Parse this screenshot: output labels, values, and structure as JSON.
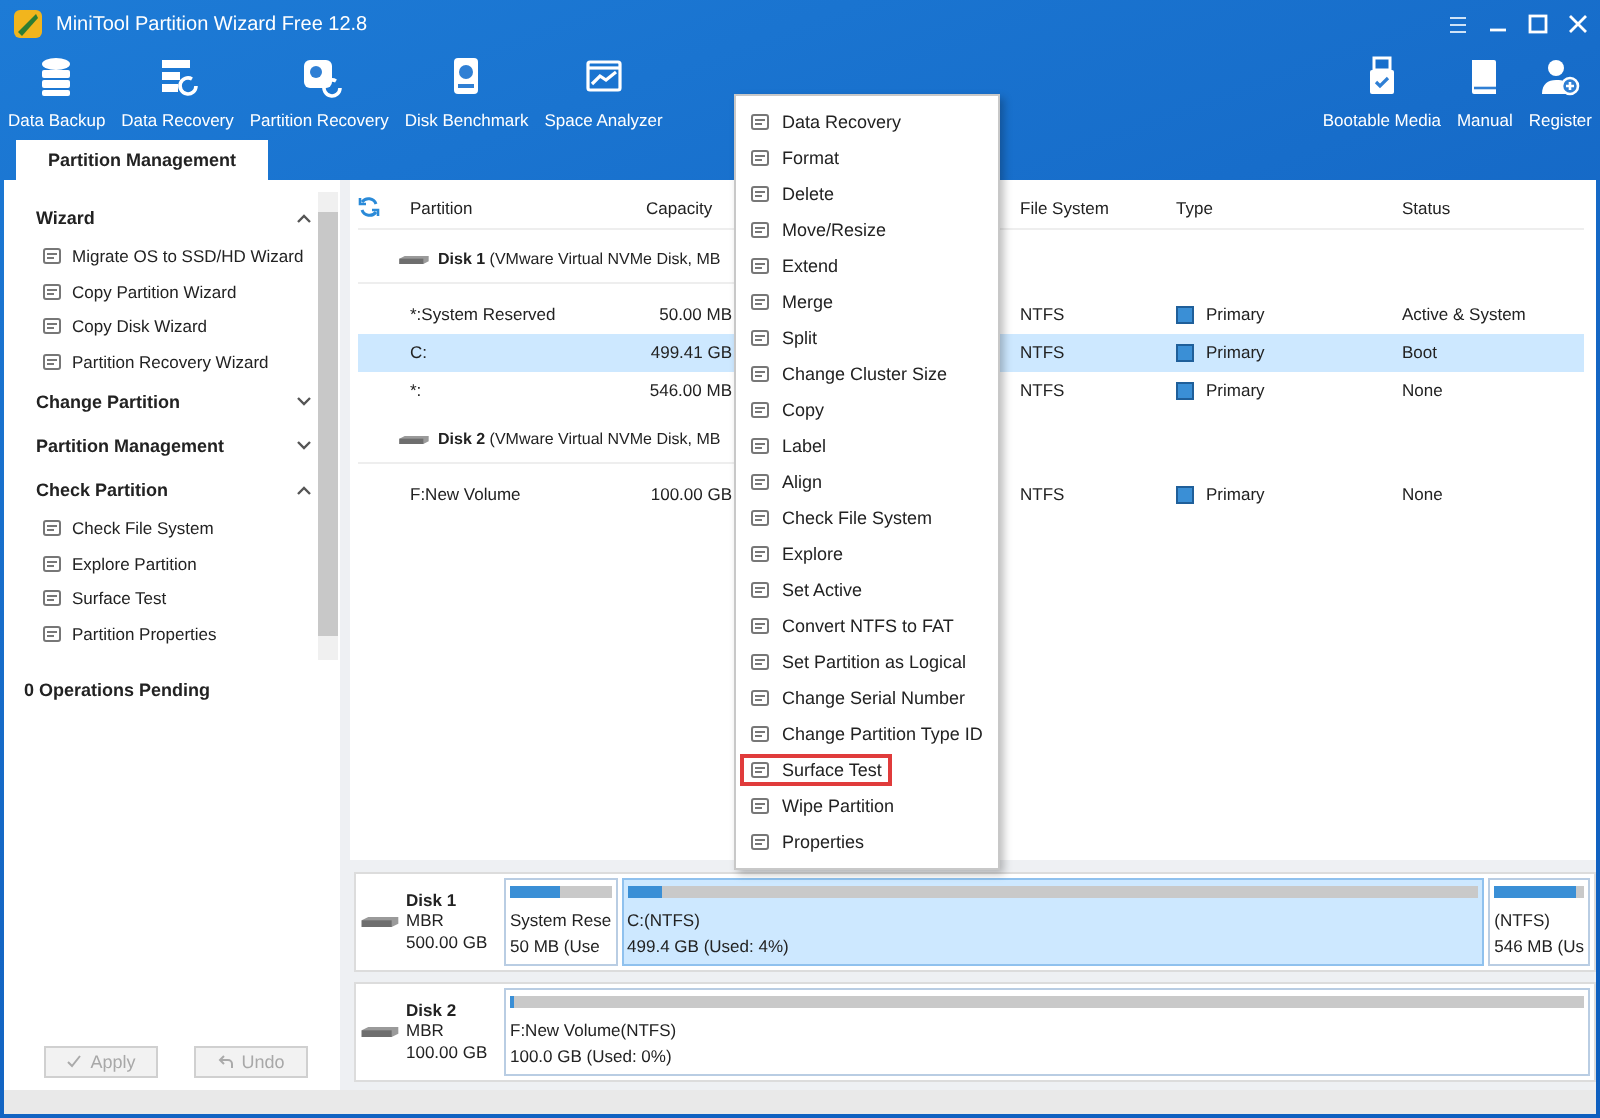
{
  "window": {
    "title": "MiniTool Partition Wizard Free 12.8"
  },
  "toolbar": {
    "left": [
      "Data Backup",
      "Data Recovery",
      "Partition Recovery",
      "Disk Benchmark",
      "Space Analyzer"
    ],
    "right": [
      "Bootable Media",
      "Manual",
      "Register"
    ]
  },
  "tabs": [
    {
      "label": "Partition Management",
      "selected": true
    }
  ],
  "sidebar": {
    "sections": [
      {
        "title": "Wizard",
        "expanded": true,
        "items": [
          "Migrate OS to SSD/HD Wizard",
          "Copy Partition Wizard",
          "Copy Disk Wizard",
          "Partition Recovery Wizard"
        ]
      },
      {
        "title": "Change Partition",
        "expanded": false
      },
      {
        "title": "Partition Management",
        "expanded": false
      },
      {
        "title": "Check Partition",
        "expanded": true,
        "items": [
          "Check File System",
          "Explore Partition",
          "Surface Test",
          "Partition Properties"
        ]
      }
    ],
    "operations_pending": "0 Operations Pending",
    "buttons": [
      {
        "label": "Apply",
        "disabled": true
      },
      {
        "label": "Undo",
        "disabled": true
      }
    ]
  },
  "table": {
    "columns": [
      "Partition",
      "Capacity",
      "File System",
      "Type",
      "Status"
    ],
    "rows": [
      {
        "kind": "disk",
        "text": "**Disk 1** (VMware Virtual NVMe Disk, MB"
      },
      {
        "kind": "partition",
        "partition": "*:System Reserved",
        "capacity": "50.00 MB",
        "file_system": "NTFS",
        "type": "Primary",
        "status": "Active & System",
        "selected": false
      },
      {
        "kind": "partition",
        "partition": "C:",
        "capacity": "499.41 GB",
        "file_system": "NTFS",
        "type": "Primary",
        "status": "Boot",
        "selected": true
      },
      {
        "kind": "partition",
        "partition": "*:",
        "capacity": "546.00 MB",
        "file_system": "NTFS",
        "type": "Primary",
        "status": "None",
        "selected": false
      },
      {
        "kind": "disk",
        "text": "**Disk 2** (VMware Virtual NVMe Disk, MB"
      },
      {
        "kind": "partition",
        "partition": "F:New Volume",
        "capacity": "100.00 GB",
        "file_system": "NTFS",
        "type": "Primary",
        "status": "None",
        "selected": false
      }
    ]
  },
  "disk_map": [
    {
      "name": "Disk 1",
      "scheme": "MBR",
      "size": "500.00 GB",
      "partitions": [
        {
          "label": "System Rese",
          "detail": "50 MB (Use",
          "level": 0.5,
          "selected": false,
          "kind": "small"
        },
        {
          "label": "C:(NTFS)",
          "detail": "499.4 GB (Used: 4%)",
          "level": 0.04,
          "selected": true,
          "kind": "wide"
        },
        {
          "label": "(NTFS)",
          "detail": "546 MB (Us",
          "level": 0.9,
          "selected": false,
          "kind": "small"
        }
      ]
    },
    {
      "name": "Disk 2",
      "scheme": "MBR",
      "size": "100.00 GB",
      "partitions": [
        {
          "label": "F:New Volume(NTFS)",
          "detail": "100.0 GB (Used: 0%)",
          "level": 0.0,
          "selected": false,
          "kind": "wide"
        }
      ]
    }
  ],
  "context_menu": {
    "items": [
      {
        "label": "Data Recovery",
        "highlighted": false
      },
      {
        "label": "Format",
        "highlighted": false
      },
      {
        "label": "Delete",
        "highlighted": false
      },
      {
        "label": "Move/Resize",
        "highlighted": false
      },
      {
        "label": "Extend",
        "highlighted": false
      },
      {
        "label": "Merge",
        "highlighted": false
      },
      {
        "label": "Split",
        "highlighted": false
      },
      {
        "label": "Change Cluster Size",
        "highlighted": false
      },
      {
        "label": "Copy",
        "highlighted": false
      },
      {
        "label": "Label",
        "highlighted": false
      },
      {
        "label": "Align",
        "highlighted": false
      },
      {
        "label": "Check File System",
        "highlighted": false
      },
      {
        "label": "Explore",
        "highlighted": false
      },
      {
        "label": "Set Active",
        "highlighted": false
      },
      {
        "label": "Convert NTFS to FAT",
        "highlighted": false
      },
      {
        "label": "Set Partition as Logical",
        "highlighted": false
      },
      {
        "label": "Change Serial Number",
        "highlighted": false
      },
      {
        "label": "Change Partition Type ID",
        "highlighted": false
      },
      {
        "label": "Surface Test",
        "highlighted": true
      },
      {
        "label": "Wipe Partition",
        "highlighted": false
      },
      {
        "label": "Properties",
        "highlighted": false
      }
    ]
  }
}
